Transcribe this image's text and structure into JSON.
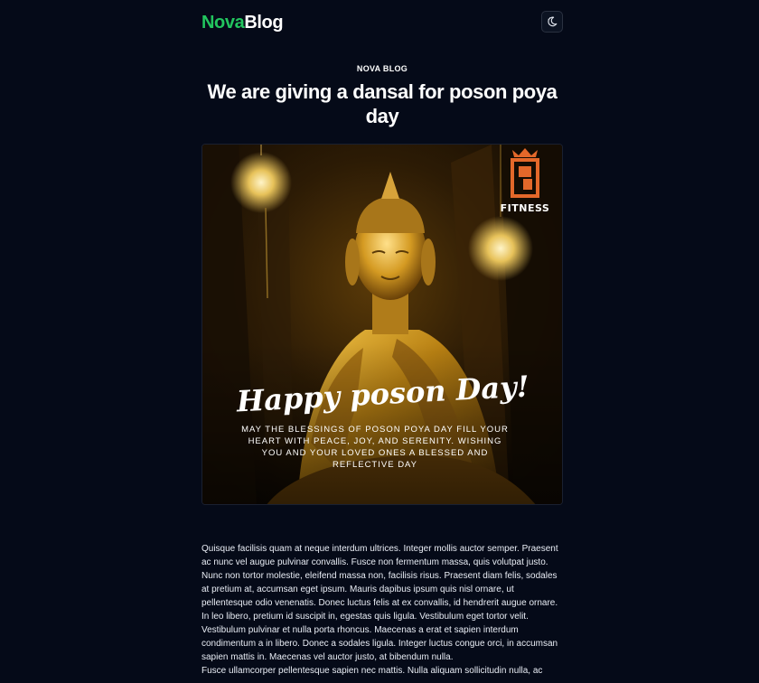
{
  "header": {
    "brand_primary": "Nova",
    "brand_secondary": "Blog",
    "brand_primary_color": "#22c55e",
    "theme_toggle_icon": "moon-icon"
  },
  "article": {
    "kicker": "NOVA BLOG",
    "title": "We are giving a dansal for poson poya day",
    "image": {
      "logo_text": "FITNESS",
      "headline": "Happy poson Day!",
      "blessing_lines": [
        "MAY THE BLESSINGS OF POSON POYA DAY FILL YOUR",
        "HEART WITH PEACE, JOY, AND SERENITY. WISHING",
        "YOU AND YOUR LOVED ONES A BLESSED AND",
        "REFLECTIVE DAY"
      ],
      "accent_color": "#e4682a"
    },
    "paragraphs": [
      "Quisque facilisis quam at neque interdum ultrices. Integer mollis auctor semper. Praesent ac nunc vel augue pulvinar convallis. Fusce non fermentum massa, quis volutpat justo. Nunc non tortor molestie, eleifend massa non, facilisis risus. Praesent diam felis, sodales at pretium at, accumsan eget ipsum. Mauris dapibus ipsum quis nisl ornare, ut pellentesque odio venenatis. Donec luctus felis at ex convallis, id hendrerit augue ornare. In leo libero, pretium id suscipit in, egestas quis ligula. Vestibulum eget tortor velit. Vestibulum pulvinar et nulla porta rhoncus. Maecenas a erat et sapien interdum condimentum a in libero. Donec a sodales ligula. Integer luctus congue orci, in accumsan sapien mattis in. Maecenas vel auctor justo, at bibendum nulla.",
      "Fusce ullamcorper pellentesque sapien nec mattis. Nulla aliquam sollicitudin nulla, ac"
    ]
  }
}
